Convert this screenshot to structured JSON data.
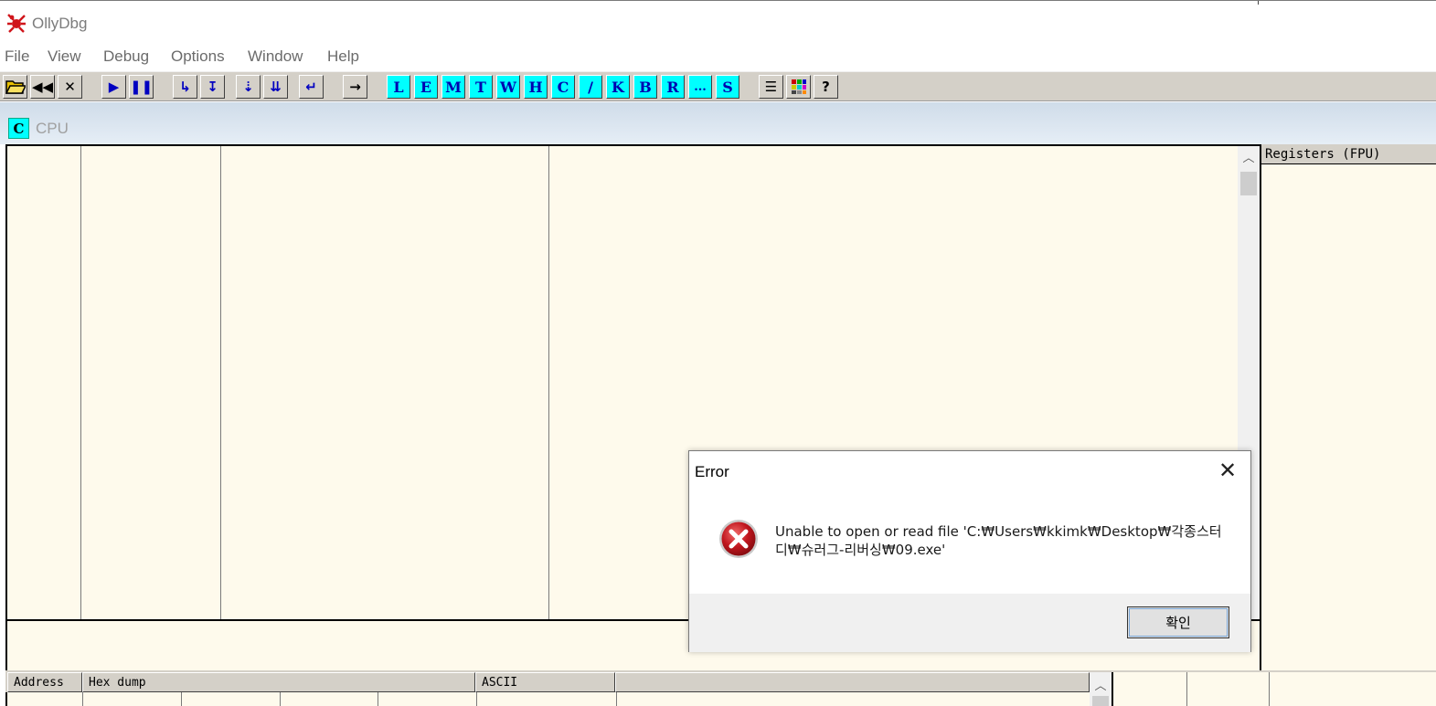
{
  "window": {
    "title": "OllyDbg",
    "icon": "ollydbg-bug-icon"
  },
  "menu": [
    "File",
    "View",
    "Debug",
    "Options",
    "Window",
    "Help"
  ],
  "toolbar": {
    "buttons": [
      {
        "name": "open-file-icon",
        "glyph": "📂"
      },
      {
        "name": "restart-icon",
        "glyph": "⏮"
      },
      {
        "name": "close-icon",
        "glyph": "✕"
      },
      {
        "name": "run-icon",
        "glyph": "▶"
      },
      {
        "name": "pause-icon",
        "glyph": "❚❚"
      },
      {
        "name": "step-into-icon",
        "glyph": "↳"
      },
      {
        "name": "step-over-icon",
        "glyph": "↧"
      },
      {
        "name": "trace-into-icon",
        "glyph": "⇣"
      },
      {
        "name": "trace-over-icon",
        "glyph": "⇊"
      },
      {
        "name": "execute-till-return-icon",
        "glyph": "↵"
      },
      {
        "name": "go-to-icon",
        "glyph": "→"
      }
    ],
    "window_buttons": [
      "L",
      "E",
      "M",
      "T",
      "W",
      "H",
      "C",
      "/",
      "K",
      "B",
      "R",
      "...",
      "S"
    ],
    "extra_buttons": [
      {
        "name": "list-icon",
        "glyph": "☰"
      },
      {
        "name": "colors-icon",
        "glyph": "▦"
      },
      {
        "name": "help-icon",
        "glyph": "?"
      }
    ]
  },
  "tab": {
    "icon_letter": "C",
    "label": "CPU"
  },
  "registers": {
    "header": "Registers (FPU)"
  },
  "dump": {
    "headers": [
      "Address",
      "Hex dump",
      "ASCII"
    ]
  },
  "dialog": {
    "title": "Error",
    "close_glyph": "✕",
    "message": "Unable to open or read file 'C:₩Users₩kkimk₩Desktop₩각종스터디₩슈러그-리버싱₩09.exe'",
    "ok_label": "확인",
    "colors": {
      "icon_red": "#c0161e"
    }
  },
  "colors": {
    "pane_bg": "#fefaec",
    "toolbar_bg": "#d4d0c8",
    "cyan_button": "#00ffff",
    "button_text": "#0000b0"
  }
}
